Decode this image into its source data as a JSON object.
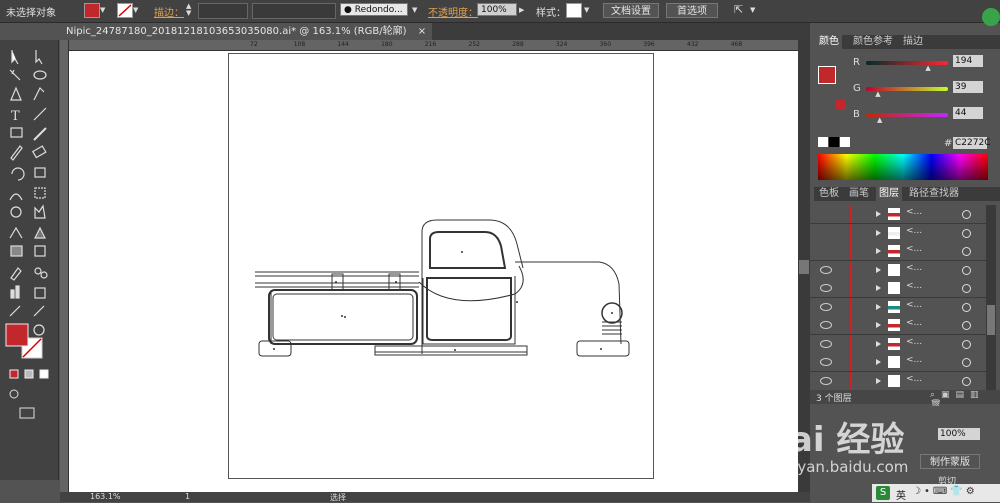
{
  "control_bar": {
    "selection_status": "未选择对象",
    "stroke_label": "描边：",
    "brush_name": "Redondo...",
    "opacity_label": "不透明度：",
    "opacity_value": "100%",
    "style_label": "样式：",
    "doc_settings_button": "文档设置",
    "preferences_button": "首选项",
    "fill_color": "#c2272c"
  },
  "document": {
    "tab_title": "Nipic_24787180_20181218103653035080.ai* @ 163.1% (RGB/轮廓)",
    "close_glyph": "×",
    "ruler_ticks": [
      "72",
      "108",
      "144",
      "180",
      "216",
      "252",
      "288",
      "324",
      "360",
      "396",
      "432",
      "468"
    ],
    "zoom": "163.1%",
    "page": "1",
    "status_text": "选择"
  },
  "color_panel": {
    "tabs": [
      "颜色",
      "颜色参考",
      "描边"
    ],
    "r_label": "R",
    "r_value": "194",
    "r_fraction": 0.76,
    "g_label": "G",
    "g_value": "39",
    "g_fraction": 0.15,
    "b_label": "B",
    "b_value": "44",
    "b_fraction": 0.17,
    "hex_label": "#",
    "hex": "C2272C",
    "fill_color": "#c2272c"
  },
  "layers_panel": {
    "tabs": [
      "色板",
      "画笔",
      "图层",
      "路径查找器"
    ],
    "rows": [
      {
        "name": "<...",
        "visible": false
      },
      {
        "name": "<...",
        "visible": false
      },
      {
        "name": "<...",
        "visible": false
      },
      {
        "name": "<...",
        "visible": true
      },
      {
        "name": "<...",
        "visible": true
      },
      {
        "name": "<...",
        "visible": true
      },
      {
        "name": "<...",
        "visible": true
      },
      {
        "name": "<...",
        "visible": true
      },
      {
        "name": "<...",
        "visible": true
      },
      {
        "name": "<...",
        "visible": true
      }
    ],
    "layer_count": "3 个图层",
    "lower_value": "100%",
    "lower_button_1": "制作蒙版",
    "lower_button_2": "剪切"
  },
  "taskbar": {
    "ime_label": "英"
  },
  "watermark": {
    "brand": "Bai 经验",
    "url": "jingyan.baidu.com"
  }
}
